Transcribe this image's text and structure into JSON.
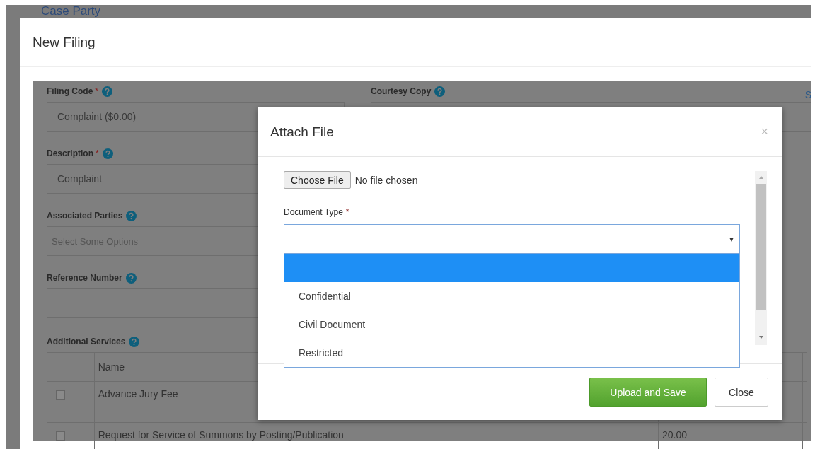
{
  "background_page": {
    "heading": "Case Party"
  },
  "new_filing": {
    "title": "New Filing",
    "fields": [
      {
        "label": "Filing Code",
        "required_mark": "*",
        "help": true,
        "value": "Complaint ($0.00)"
      },
      {
        "label": "Description",
        "required_mark": "*",
        "help": true,
        "value": "Complaint"
      },
      {
        "label": "Associated Parties",
        "help": true,
        "placeholder": "Select Some Options"
      },
      {
        "label": "Reference Number",
        "help": true
      }
    ],
    "courtesy_copy": {
      "label": "Courtesy Copy",
      "help": true
    },
    "side_link": "S",
    "additional_services": {
      "label": "Additional Services",
      "help": true,
      "columns": [
        "Name"
      ],
      "rows": [
        {
          "checked": false,
          "name": "Advance Jury Fee"
        },
        {
          "checked": false,
          "name": "Request for Service of Summons by Posting/Publication",
          "column_3": "20.00"
        }
      ]
    }
  },
  "attach_file": {
    "title": "Attach File",
    "close_icon": "×",
    "choose_button": "Choose File",
    "file_status": "No file chosen",
    "document_type": {
      "label": "Document Type",
      "required_mark": "*",
      "arrow": "▾",
      "options": [
        {
          "selected": true
        },
        {
          "label": "Confidential",
          "selected": false
        },
        {
          "label": "Civil Document",
          "selected": false
        },
        {
          "label": "Restricted",
          "selected": false
        }
      ]
    },
    "buttons": [
      {
        "label": "Upload and Save",
        "kind": "primary"
      },
      {
        "label": "Close",
        "kind": "default"
      }
    ]
  }
}
